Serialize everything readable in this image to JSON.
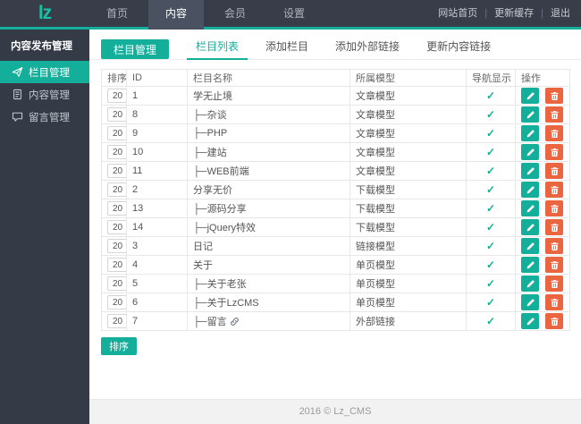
{
  "header": {
    "logo": "lz",
    "nav": [
      {
        "label": "首页",
        "active": false
      },
      {
        "label": "内容",
        "active": true
      },
      {
        "label": "会员",
        "active": false
      },
      {
        "label": "设置",
        "active": false
      }
    ],
    "links": [
      "网站首页",
      "更新缓存",
      "退出"
    ],
    "separator": "|"
  },
  "sidebar": {
    "title": "内容发布管理",
    "items": [
      {
        "label": "栏目管理",
        "icon": "paper-plane-icon",
        "active": true
      },
      {
        "label": "内容管理",
        "icon": "document-icon",
        "active": false
      },
      {
        "label": "留言管理",
        "icon": "comment-icon",
        "active": false
      }
    ]
  },
  "toolbar": {
    "panel_button": "栏目管理",
    "tabs": [
      {
        "label": "栏目列表",
        "active": true
      },
      {
        "label": "添加栏目",
        "active": false
      },
      {
        "label": "添加外部链接",
        "active": false
      },
      {
        "label": "更新内容链接",
        "active": false
      }
    ]
  },
  "table": {
    "headers": [
      "排序",
      "ID",
      "栏目名称",
      "所属模型",
      "导航显示",
      "操作"
    ],
    "check_glyph": "✓",
    "rows": [
      {
        "sort": "20",
        "id": "1",
        "name": "学无止境",
        "model": "文章模型",
        "model_external": false,
        "nav_shown": true,
        "has_link_icon": false
      },
      {
        "sort": "20",
        "id": "8",
        "name": "├─杂谈",
        "model": "文章模型",
        "model_external": false,
        "nav_shown": true,
        "has_link_icon": false
      },
      {
        "sort": "20",
        "id": "9",
        "name": "├─PHP",
        "model": "文章模型",
        "model_external": false,
        "nav_shown": true,
        "has_link_icon": false
      },
      {
        "sort": "20",
        "id": "10",
        "name": "├─建站",
        "model": "文章模型",
        "model_external": false,
        "nav_shown": true,
        "has_link_icon": false
      },
      {
        "sort": "20",
        "id": "11",
        "name": "├─WEB前端",
        "model": "文章模型",
        "model_external": false,
        "nav_shown": true,
        "has_link_icon": false
      },
      {
        "sort": "20",
        "id": "2",
        "name": "分享无价",
        "model": "下载模型",
        "model_external": false,
        "nav_shown": true,
        "has_link_icon": false
      },
      {
        "sort": "20",
        "id": "13",
        "name": "├─源码分享",
        "model": "下载模型",
        "model_external": false,
        "nav_shown": true,
        "has_link_icon": false
      },
      {
        "sort": "20",
        "id": "14",
        "name": "├─jQuery特效",
        "model": "下载模型",
        "model_external": false,
        "nav_shown": true,
        "has_link_icon": false
      },
      {
        "sort": "20",
        "id": "3",
        "name": "日记",
        "model": "链接模型",
        "model_external": false,
        "nav_shown": true,
        "has_link_icon": false
      },
      {
        "sort": "20",
        "id": "4",
        "name": "关于",
        "model": "单页模型",
        "model_external": false,
        "nav_shown": true,
        "has_link_icon": false
      },
      {
        "sort": "20",
        "id": "5",
        "name": "├─关于老张",
        "model": "单页模型",
        "model_external": false,
        "nav_shown": true,
        "has_link_icon": false
      },
      {
        "sort": "20",
        "id": "6",
        "name": "├─关于LzCMS",
        "model": "单页模型",
        "model_external": false,
        "nav_shown": true,
        "has_link_icon": false
      },
      {
        "sort": "20",
        "id": "7",
        "name": "├─留言",
        "model": "外部链接",
        "model_external": true,
        "nav_shown": true,
        "has_link_icon": true
      }
    ]
  },
  "sort_button": "排序",
  "footer": {
    "copyright": "2016 © Lz_CMS"
  },
  "colors": {
    "accent": "#14AF9B",
    "danger": "#EC6541",
    "external_link": "#E8543C",
    "topbar": "#393D49",
    "sidebar": "#343B47"
  }
}
